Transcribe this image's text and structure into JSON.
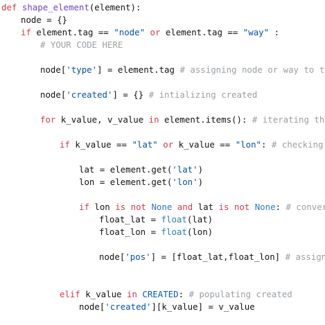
{
  "code": {
    "lines": [
      {
        "indent": 0,
        "tokens": [
          {
            "t": "def",
            "c": "kw"
          },
          {
            "t": " "
          },
          {
            "t": "shape_element",
            "c": "fn"
          },
          {
            "t": "(element):"
          }
        ]
      },
      {
        "indent": 4,
        "tokens": [
          {
            "t": "node = {}"
          }
        ]
      },
      {
        "indent": 4,
        "tokens": [
          {
            "t": "if",
            "c": "kw"
          },
          {
            "t": " element.tag == "
          },
          {
            "t": "\"node\"",
            "c": "str"
          },
          {
            "t": " "
          },
          {
            "t": "or",
            "c": "kw"
          },
          {
            "t": " element.tag == "
          },
          {
            "t": "\"way\"",
            "c": "str"
          },
          {
            "t": " :"
          }
        ]
      },
      {
        "indent": 8,
        "tokens": [
          {
            "t": "# YOUR CODE HERE",
            "c": "cm"
          }
        ]
      },
      {
        "indent": 8,
        "tokens": []
      },
      {
        "indent": 8,
        "tokens": [
          {
            "t": "node["
          },
          {
            "t": "'type'",
            "c": "str"
          },
          {
            "t": "] = element.tag "
          },
          {
            "t": "# assigning node or way to type",
            "c": "cm"
          }
        ]
      },
      {
        "indent": 8,
        "tokens": []
      },
      {
        "indent": 8,
        "tokens": [
          {
            "t": "node["
          },
          {
            "t": "'created'",
            "c": "str"
          },
          {
            "t": "] = {} "
          },
          {
            "t": "# intializing created",
            "c": "cm"
          }
        ]
      },
      {
        "indent": 8,
        "tokens": []
      },
      {
        "indent": 8,
        "tokens": [
          {
            "t": "for",
            "c": "kw"
          },
          {
            "t": " k_value, v_value "
          },
          {
            "t": "in",
            "c": "kw"
          },
          {
            "t": " element.items(): "
          },
          {
            "t": "# iterating through",
            "c": "cm"
          }
        ]
      },
      {
        "indent": 8,
        "tokens": []
      },
      {
        "indent": 12,
        "tokens": [
          {
            "t": "if",
            "c": "kw"
          },
          {
            "t": " k_value == "
          },
          {
            "t": "\"lat\"",
            "c": "str"
          },
          {
            "t": " "
          },
          {
            "t": "or",
            "c": "kw"
          },
          {
            "t": " k_value == "
          },
          {
            "t": "\"lon\"",
            "c": "str"
          },
          {
            "t": ": "
          },
          {
            "t": "# checking for",
            "c": "cm"
          }
        ]
      },
      {
        "indent": 12,
        "tokens": []
      },
      {
        "indent": 16,
        "tokens": [
          {
            "t": "lat = element.get("
          },
          {
            "t": "'lat'",
            "c": "str"
          },
          {
            "t": ")"
          }
        ]
      },
      {
        "indent": 16,
        "tokens": [
          {
            "t": "lon = element.get("
          },
          {
            "t": "'lon'",
            "c": "str"
          },
          {
            "t": ")"
          }
        ]
      },
      {
        "indent": 16,
        "tokens": []
      },
      {
        "indent": 16,
        "tokens": [
          {
            "t": "if",
            "c": "kw"
          },
          {
            "t": " lon "
          },
          {
            "t": "is not",
            "c": "kw"
          },
          {
            "t": " "
          },
          {
            "t": "None",
            "c": "bi"
          },
          {
            "t": " "
          },
          {
            "t": "and",
            "c": "kw"
          },
          {
            "t": " lat "
          },
          {
            "t": "is not",
            "c": "kw"
          },
          {
            "t": " "
          },
          {
            "t": "None",
            "c": "bi"
          },
          {
            "t": ": "
          },
          {
            "t": "# converting",
            "c": "cm"
          }
        ]
      },
      {
        "indent": 20,
        "tokens": [
          {
            "t": "float_lat = "
          },
          {
            "t": "float",
            "c": "bi"
          },
          {
            "t": "(lat)"
          }
        ]
      },
      {
        "indent": 20,
        "tokens": [
          {
            "t": "float_lon = "
          },
          {
            "t": "float",
            "c": "bi"
          },
          {
            "t": "(lon)"
          }
        ]
      },
      {
        "indent": 20,
        "tokens": []
      },
      {
        "indent": 20,
        "tokens": [
          {
            "t": "node["
          },
          {
            "t": "'pos'",
            "c": "str"
          },
          {
            "t": "] = [float_lat,float_lon] "
          },
          {
            "t": "# assigning",
            "c": "cm"
          }
        ]
      },
      {
        "indent": 20,
        "tokens": []
      },
      {
        "indent": 20,
        "tokens": []
      },
      {
        "indent": 12,
        "tokens": [
          {
            "t": "elif",
            "c": "kw"
          },
          {
            "t": " k_value "
          },
          {
            "t": "in",
            "c": "kw"
          },
          {
            "t": " "
          },
          {
            "t": "CREATED",
            "c": "num"
          },
          {
            "t": ": "
          },
          {
            "t": "# populating created",
            "c": "cm"
          }
        ]
      },
      {
        "indent": 16,
        "tokens": [
          {
            "t": "node["
          },
          {
            "t": "'created'",
            "c": "str"
          },
          {
            "t": "][k_value] = v_value"
          }
        ]
      }
    ]
  }
}
